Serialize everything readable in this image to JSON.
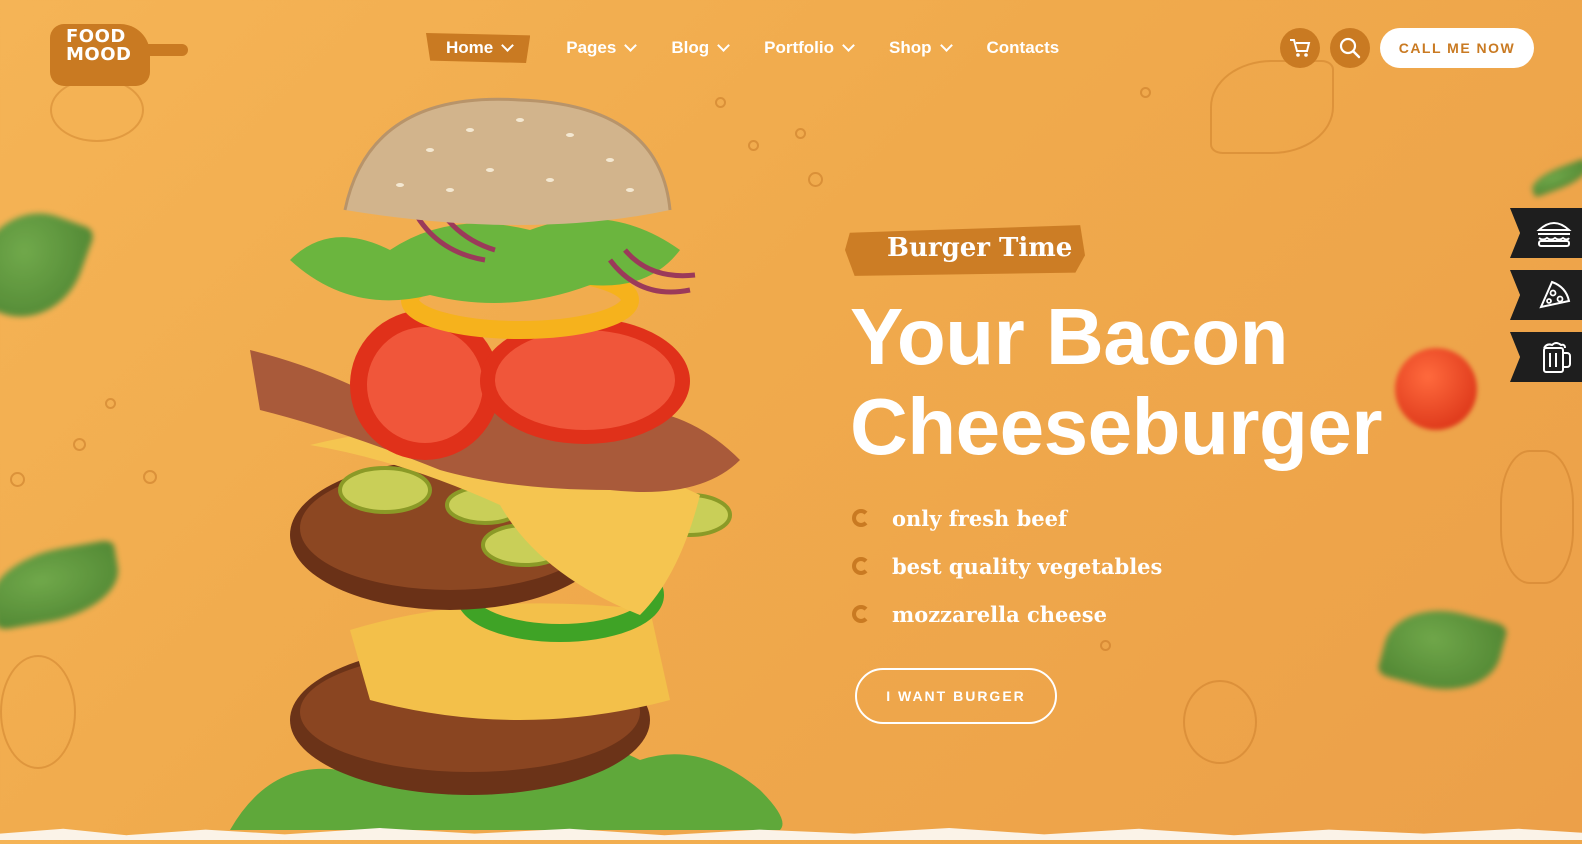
{
  "brand": {
    "logo_line1": "FOOD",
    "logo_line2": "MOOD"
  },
  "nav": {
    "items": [
      {
        "label": "Home",
        "active": true,
        "has_dropdown": true
      },
      {
        "label": "Pages",
        "active": false,
        "has_dropdown": true
      },
      {
        "label": "Blog",
        "active": false,
        "has_dropdown": true
      },
      {
        "label": "Portfolio",
        "active": false,
        "has_dropdown": true
      },
      {
        "label": "Shop",
        "active": false,
        "has_dropdown": true
      },
      {
        "label": "Contacts",
        "active": false,
        "has_dropdown": false
      }
    ]
  },
  "header": {
    "cart_icon": "cart-icon",
    "search_icon": "search-icon",
    "call_label": "CALL ME NOW"
  },
  "side_tabs": [
    {
      "icon": "burger-icon"
    },
    {
      "icon": "pizza-icon"
    },
    {
      "icon": "beer-icon"
    }
  ],
  "hero": {
    "tag": "Burger Time",
    "title_line1": "Your Bacon",
    "title_line2": "Cheeseburger",
    "features": [
      "only fresh beef",
      "best quality vegetables",
      "mozzarella cheese"
    ],
    "cta_label": "I WANT BURGER"
  },
  "colors": {
    "background": "#f0aa4c",
    "accent": "#c97a22",
    "text": "#ffffff",
    "dark_tab": "#1e1e1e"
  }
}
